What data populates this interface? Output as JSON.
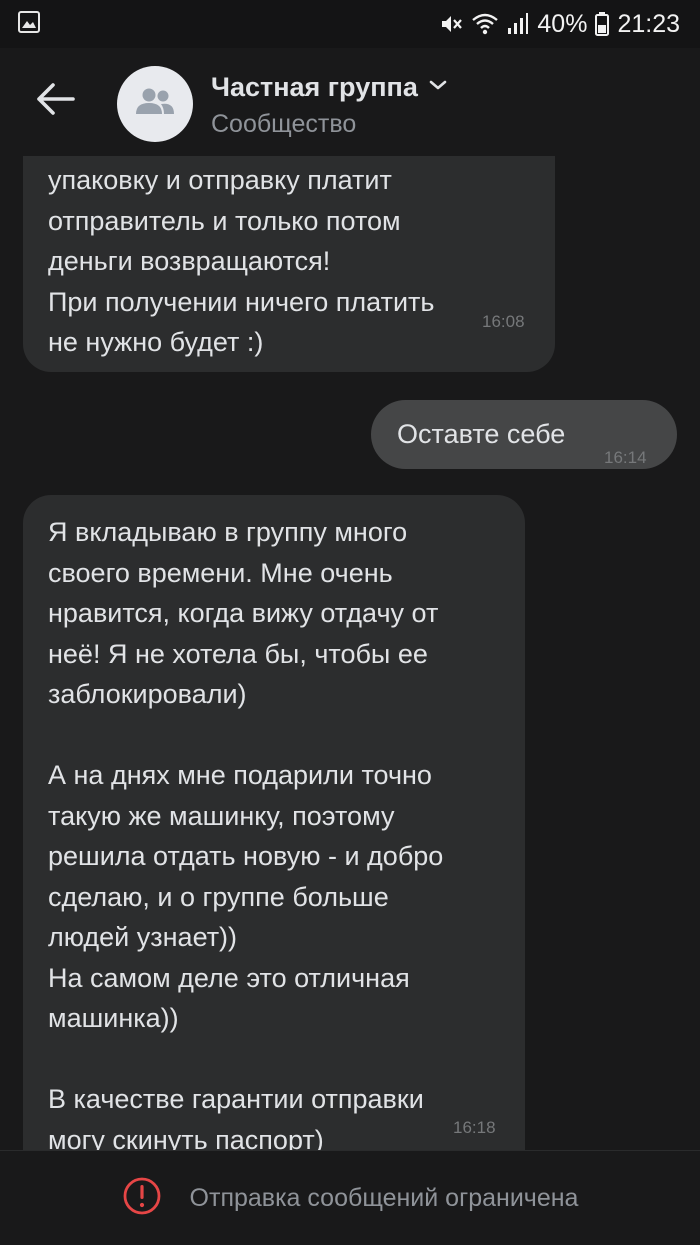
{
  "status_bar": {
    "battery": "40%",
    "time": "21:23",
    "icons": [
      "gallery-icon",
      "mute-icon",
      "wifi-icon",
      "signal-icon",
      "battery-icon"
    ]
  },
  "header": {
    "title": "Частная группа",
    "subtitle": "Сообщество",
    "icons": [
      "back-arrow-icon",
      "group-avatar-icon",
      "chevron-down-icon"
    ]
  },
  "messages": [
    {
      "direction": "incoming",
      "text": "упаковку и отправку платит\nотправитель и только потом\nденьги возвращаются!\nПри получении ничего платить\nне нужно будет :)",
      "time": "16:08"
    },
    {
      "direction": "outgoing",
      "text": "Оставте себе",
      "time": "16:14"
    },
    {
      "direction": "incoming",
      "text": "Я вкладываю в группу много\nсвоего времени. Мне очень\nнравится, когда вижу отдачу от\nнеё! Я не хотела бы, чтобы ее\nзаблокировали)\n\nА на днях мне подарили точно\nтакую же машинку, поэтому\nрешила отдать новую - и добро\nсделаю, и о группе больше\nлюдей узнает))\nНа самом деле это отличная\nмашинка))\n\nВ качестве гарантии отправки\nмогу скинуть паспорт)",
      "time": "16:18"
    }
  ],
  "footer": {
    "notice": "Отправка сообщений ограничена",
    "icon": "error-icon",
    "accent_color": "#e64646"
  },
  "colors": {
    "background": "#19191a",
    "incoming_bubble": "#2c2d2e",
    "outgoing_bubble": "#454647",
    "text": "#e1e3e6",
    "secondary_text": "#8f9399"
  }
}
